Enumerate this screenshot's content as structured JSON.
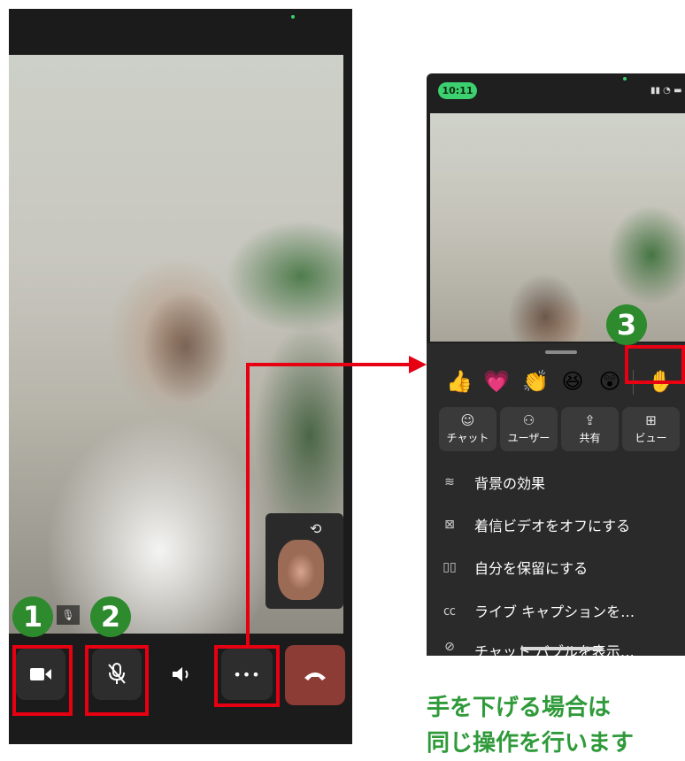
{
  "left_call": {
    "controls": {
      "video_icon": "video-camera-icon",
      "mic_icon": "microphone-muted-icon",
      "speaker_icon": "speaker-icon",
      "more_label": "•••",
      "hangup_icon": "hang-up-phone-icon"
    }
  },
  "right_call": {
    "status": {
      "time": "10:11"
    },
    "reactions": [
      "👍",
      "💗",
      "👏",
      "😆",
      "😲",
      "✋"
    ],
    "actions": [
      {
        "icon": "chat-icon",
        "glyph": "☺",
        "label": "チャット"
      },
      {
        "icon": "users-icon",
        "glyph": "⚇",
        "label": "ユーザー"
      },
      {
        "icon": "share-icon",
        "glyph": "⇪",
        "label": "共有"
      },
      {
        "icon": "view-icon",
        "glyph": "⊞",
        "label": "ビュー"
      }
    ],
    "menu": [
      {
        "icon": "background-effects-icon",
        "glyph": "≋",
        "label": "背景の効果"
      },
      {
        "icon": "video-off-icon",
        "glyph": "⊠",
        "label": "着信ビデオをオフにする"
      },
      {
        "icon": "hold-icon",
        "glyph": "▯▯",
        "label": "自分を保留にする"
      },
      {
        "icon": "caption-icon",
        "glyph": "㏄",
        "label": "ライブ キャプションを…"
      },
      {
        "icon": "chat-bubble-off-icon",
        "glyph": "⊘",
        "label": "チャット バブルを表示…"
      }
    ]
  },
  "annotations": {
    "step1": "1",
    "step2": "2",
    "step3": "3",
    "accent": "#e60012",
    "badge_color": "#2d8a2d"
  },
  "note": {
    "line1": "手を下げる場合は",
    "line2": "同じ操作を行います"
  }
}
